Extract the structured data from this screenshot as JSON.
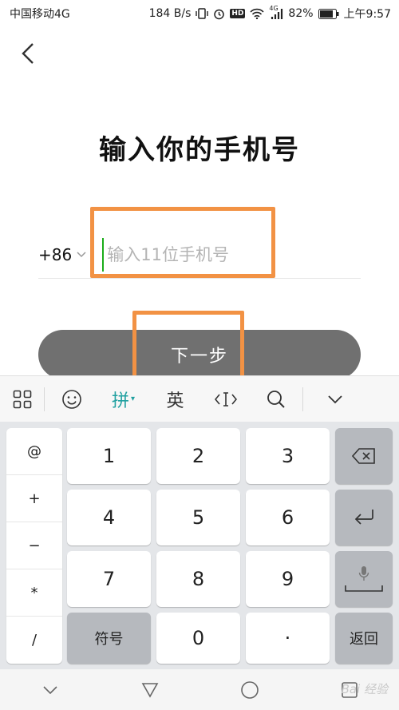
{
  "status_bar": {
    "carrier": "中国移动4G",
    "speed": "184 B/s",
    "hd": "HD",
    "network": "4G",
    "battery": "82%",
    "time": "上午9:57"
  },
  "header": {
    "title": "输入你的手机号"
  },
  "phone": {
    "country_code": "+86",
    "placeholder": "输入11位手机号"
  },
  "actions": {
    "next_label": "下一步"
  },
  "ime_toolbar": {
    "pinyin_label": "拼",
    "english_label": "英"
  },
  "keyboard": {
    "symbols": [
      "@",
      "+",
      "−",
      "*",
      "/"
    ],
    "digit_rows": [
      [
        "1",
        "2",
        "3"
      ],
      [
        "4",
        "5",
        "6"
      ],
      [
        "7",
        "8",
        "9"
      ]
    ],
    "symbols_key": "符号",
    "zero": "0",
    "dot": "·",
    "return_key": "返回"
  },
  "watermark": "Bai 经验",
  "colors": {
    "accent_green": "#1aad19",
    "highlight_orange": "#f29244",
    "button_gray": "#707070"
  }
}
